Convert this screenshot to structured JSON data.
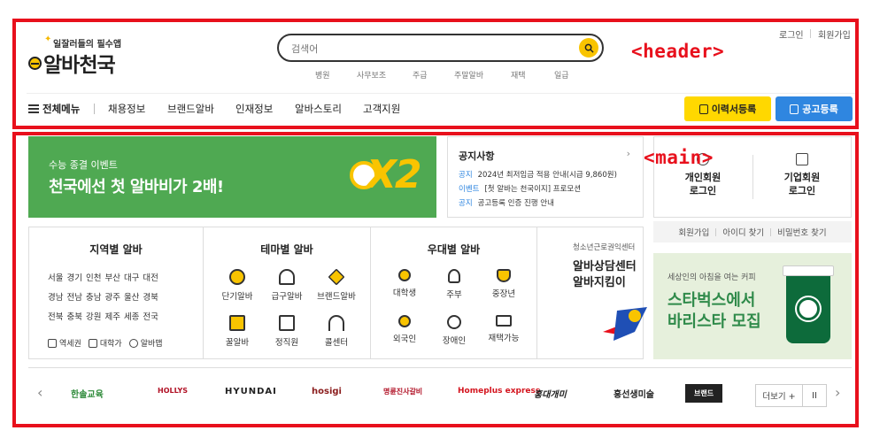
{
  "annotations": {
    "header": "<header>",
    "main": "<main>"
  },
  "header": {
    "top_links": [
      "로그인",
      "회원가입"
    ],
    "slogan": "일잘러들의 필수앱",
    "logo": "알바천국",
    "search_placeholder": "검색어",
    "keywords": [
      "병원",
      "사무보조",
      "주급",
      "주말알바",
      "재택",
      "일급"
    ],
    "menu_label": "전체메뉴",
    "nav": [
      "채용정보",
      "브랜드알바",
      "인재정보",
      "알바스토리",
      "고객지원"
    ],
    "resume_button": "이력서등록",
    "post_button": "공고등록"
  },
  "banner": {
    "subtitle": "수능 종결 이벤트",
    "title": "천국에선 첫 알바비가 2배!",
    "badge": "X2"
  },
  "notice": {
    "title": "공지사항",
    "items": [
      {
        "tag": "공지",
        "text": "2024년 최저임금 적용 안내(시급 9,860원)"
      },
      {
        "tag": "이벤트",
        "text": "[첫 알바는 천국이지] 프로모션"
      },
      {
        "tag": "공지",
        "text": "공고등록 인증 진행 안내"
      }
    ]
  },
  "login": {
    "personal": [
      "개인회원",
      "로그인"
    ],
    "company": [
      "기업회원",
      "로그인"
    ],
    "links": [
      "회원가입",
      "아이디 찾기",
      "비밀번호 찾기"
    ]
  },
  "categories": {
    "region_title": "지역별 알바",
    "regions": [
      [
        "서울",
        "경기",
        "인천",
        "부산",
        "대구",
        "대전"
      ],
      [
        "경남",
        "전남",
        "충남",
        "광주",
        "울산",
        "경북"
      ],
      [
        "전북",
        "충북",
        "강원",
        "제주",
        "세종",
        "전국"
      ]
    ],
    "region_links": [
      "역세권",
      "대학가",
      "알바맵"
    ],
    "theme_title": "테마별 알바",
    "themes": [
      "단기알바",
      "급구알바",
      "브랜드알바",
      "꿀알바",
      "정직원",
      "콜센터"
    ],
    "pref_title": "우대별 알바",
    "prefs": [
      "대학생",
      "주부",
      "중장년",
      "외국인",
      "장애인",
      "재택가능"
    ],
    "youth_small": "청소년근로권익센터",
    "youth_big": [
      "알바상담센터",
      "알바지킴이"
    ]
  },
  "ad": {
    "small": "세상인의 아침을 여는 커피",
    "big": [
      "스타벅스에서",
      "바리스타 모집"
    ]
  },
  "brands": [
    "한솔교육",
    "HOLLYS",
    "HYUNDAI",
    "hosigi",
    "명륜진사갈비",
    "Homeplus express",
    "홍대개미",
    "홍선생미술",
    "브랜드"
  ],
  "more_label": "더보기 +",
  "pause_label": "II",
  "colors": {
    "accent_yellow": "#ffd800",
    "accent_blue": "#2f86e0",
    "banner_green": "#4fa952",
    "annotation_red": "#e8101c"
  }
}
